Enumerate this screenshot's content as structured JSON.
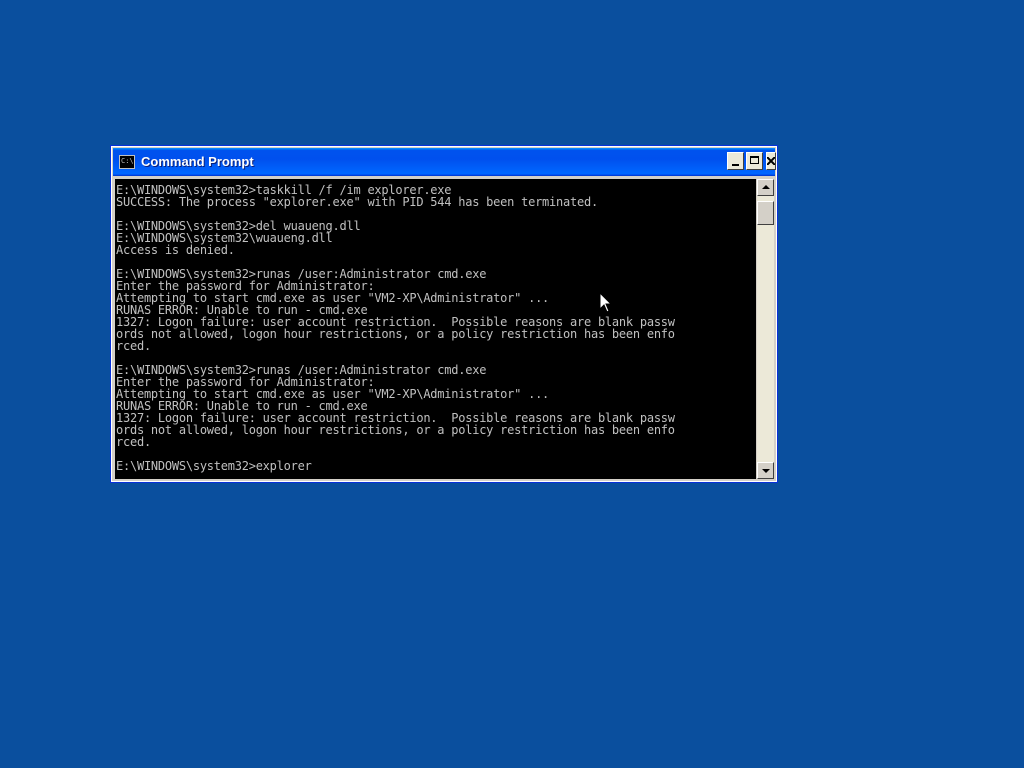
{
  "window": {
    "title": "Command Prompt",
    "icon": "cmd-icon",
    "icon_glyph": "C:\\"
  },
  "console": {
    "lines": [
      "E:\\WINDOWS\\system32>taskkill /f /im explorer.exe",
      "SUCCESS: The process \"explorer.exe\" with PID 544 has been terminated.",
      "",
      "E:\\WINDOWS\\system32>del wuaueng.dll",
      "E:\\WINDOWS\\system32\\wuaueng.dll",
      "Access is denied.",
      "",
      "E:\\WINDOWS\\system32>runas /user:Administrator cmd.exe",
      "Enter the password for Administrator:",
      "Attempting to start cmd.exe as user \"VM2-XP\\Administrator\" ...",
      "RUNAS ERROR: Unable to run - cmd.exe",
      "1327: Logon failure: user account restriction.  Possible reasons are blank passw",
      "ords not allowed, logon hour restrictions, or a policy restriction has been enfo",
      "rced.",
      "",
      "E:\\WINDOWS\\system32>runas /user:Administrator cmd.exe",
      "Enter the password for Administrator:",
      "Attempting to start cmd.exe as user \"VM2-XP\\Administrator\" ...",
      "RUNAS ERROR: Unable to run - cmd.exe",
      "1327: Logon failure: user account restriction.  Possible reasons are blank passw",
      "ords not allowed, logon hour restrictions, or a policy restriction has been enfo",
      "rced.",
      "",
      "E:\\WINDOWS\\system32>explorer"
    ]
  },
  "colors": {
    "desktop": "#0a4f9e",
    "console_bg": "#000000",
    "console_text": "#c0c0c0",
    "titlebar": "#0050ee"
  },
  "icons": {
    "minimize": "minimize-icon",
    "maximize": "maximize-icon",
    "close": "close-icon",
    "scroll_up": "chevron-up-icon",
    "scroll_down": "chevron-down-icon",
    "cursor": "mouse-pointer-icon"
  }
}
